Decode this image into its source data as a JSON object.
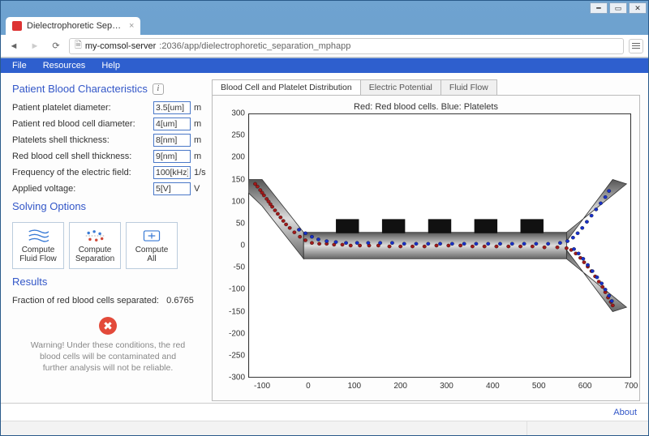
{
  "window": {
    "browser_tab_title": "Dielectrophoretic Separati",
    "url_host": "my-comsol-server",
    "url_port_path": ":2036/app/dielectrophoretic_separation_mphapp"
  },
  "menu": {
    "items": [
      "File",
      "Resources",
      "Help"
    ]
  },
  "sections": {
    "characteristics": "Patient Blood Characteristics",
    "solving": "Solving Options",
    "results": "Results"
  },
  "inputs": {
    "platelet_diam": {
      "label": "Patient platelet diameter:",
      "value": "3.5[um]",
      "unit": "m"
    },
    "rbc_diam": {
      "label": "Patient red blood cell diameter:",
      "value": "4[um]",
      "unit": "m"
    },
    "platelet_shell": {
      "label": "Platelets shell thickness:",
      "value": "8[nm]",
      "unit": "m"
    },
    "rbc_shell": {
      "label": "Red blood cell shell thickness:",
      "value": "9[nm]",
      "unit": "m"
    },
    "frequency": {
      "label": "Frequency of the electric field:",
      "value": "100[kHz]",
      "unit": "1/s"
    },
    "voltage": {
      "label": "Applied voltage:",
      "value": "5[V]",
      "unit": "V"
    }
  },
  "buttons": {
    "flow": "Compute\nFluid Flow",
    "sep": "Compute\nSeparation",
    "all": "Compute\nAll"
  },
  "results": {
    "frac_label": "Fraction of red blood cells separated:",
    "frac_value": "0.6765"
  },
  "warning": "Warning! Under these conditions, the red blood cells will be contaminated and further analysis will not be reliable.",
  "tabs": {
    "t1": "Blood Cell and Platelet Distribution",
    "t2": "Electric Potential",
    "t3": "Fluid Flow"
  },
  "plot": {
    "title": "Red: Red blood cells. Blue: Platelets",
    "y_ticks": [
      "300",
      "250",
      "200",
      "150",
      "100",
      "50",
      "0",
      "-50",
      "-100",
      "-150",
      "-200",
      "-250",
      "-300"
    ],
    "x_ticks": [
      "-100",
      "0",
      "100",
      "200",
      "300",
      "400",
      "500",
      "600",
      "700"
    ]
  },
  "chart_data": {
    "type": "scatter",
    "title": "Red: Red blood cells. Blue: Platelets",
    "xlabel": "",
    "ylabel": "",
    "xlim": [
      -130,
      700
    ],
    "ylim": [
      -300,
      300
    ],
    "notes": "Geometry is a horizontal microchannel with 5 comb electrodes; Y-shaped inlet (upper-left arm) and Y-shaped outlet (two arms on the right). Particles drawn as small circles along the channel.",
    "series": [
      {
        "name": "Red blood cells",
        "color": "#a11a1a",
        "points": [
          [
            -115,
            140
          ],
          [
            -110,
            134
          ],
          [
            -104,
            126
          ],
          [
            -100,
            120
          ],
          [
            -96,
            114
          ],
          [
            -90,
            106
          ],
          [
            -86,
            100
          ],
          [
            -82,
            94
          ],
          [
            -78,
            88
          ],
          [
            -72,
            80
          ],
          [
            -66,
            72
          ],
          [
            -60,
            64
          ],
          [
            -54,
            56
          ],
          [
            -48,
            48
          ],
          [
            -40,
            40
          ],
          [
            -30,
            30
          ],
          [
            -18,
            20
          ],
          [
            -6,
            12
          ],
          [
            8,
            6
          ],
          [
            24,
            4
          ],
          [
            40,
            4
          ],
          [
            56,
            2
          ],
          [
            74,
            2
          ],
          [
            92,
            0
          ],
          [
            112,
            0
          ],
          [
            132,
            0
          ],
          [
            152,
            0
          ],
          [
            176,
            -2
          ],
          [
            200,
            -2
          ],
          [
            226,
            -2
          ],
          [
            252,
            -2
          ],
          [
            278,
            0
          ],
          [
            304,
            0
          ],
          [
            330,
            0
          ],
          [
            356,
            -2
          ],
          [
            382,
            -2
          ],
          [
            408,
            -2
          ],
          [
            434,
            -2
          ],
          [
            460,
            -2
          ],
          [
            486,
            -2
          ],
          [
            512,
            -4
          ],
          [
            540,
            -4
          ],
          [
            560,
            -6
          ],
          [
            570,
            -10
          ],
          [
            580,
            -18
          ],
          [
            590,
            -28
          ],
          [
            598,
            -38
          ],
          [
            606,
            -48
          ],
          [
            614,
            -58
          ],
          [
            622,
            -70
          ],
          [
            630,
            -82
          ],
          [
            638,
            -94
          ],
          [
            644,
            -106
          ],
          [
            650,
            -118
          ],
          [
            656,
            -128
          ],
          [
            660,
            -136
          ]
        ]
      },
      {
        "name": "Platelets",
        "color": "#1830c8",
        "points": [
          [
            -20,
            36
          ],
          [
            -6,
            28
          ],
          [
            8,
            20
          ],
          [
            22,
            14
          ],
          [
            40,
            10
          ],
          [
            60,
            8
          ],
          [
            82,
            6
          ],
          [
            106,
            6
          ],
          [
            130,
            6
          ],
          [
            156,
            6
          ],
          [
            182,
            6
          ],
          [
            208,
            4
          ],
          [
            234,
            4
          ],
          [
            260,
            4
          ],
          [
            286,
            4
          ],
          [
            312,
            4
          ],
          [
            338,
            4
          ],
          [
            364,
            4
          ],
          [
            390,
            4
          ],
          [
            416,
            4
          ],
          [
            442,
            4
          ],
          [
            468,
            4
          ],
          [
            494,
            4
          ],
          [
            520,
            4
          ],
          [
            546,
            6
          ],
          [
            562,
            10
          ],
          [
            574,
            18
          ],
          [
            584,
            28
          ],
          [
            594,
            40
          ],
          [
            604,
            54
          ],
          [
            614,
            68
          ],
          [
            624,
            82
          ],
          [
            634,
            96
          ],
          [
            644,
            110
          ],
          [
            652,
            124
          ],
          [
            576,
            -8
          ],
          [
            586,
            -18
          ],
          [
            596,
            -30
          ],
          [
            606,
            -44
          ],
          [
            616,
            -58
          ],
          [
            626,
            -72
          ],
          [
            636,
            -86
          ],
          [
            644,
            -100
          ],
          [
            652,
            -114
          ],
          [
            658,
            -126
          ]
        ]
      }
    ]
  },
  "footer": {
    "about": "About"
  }
}
